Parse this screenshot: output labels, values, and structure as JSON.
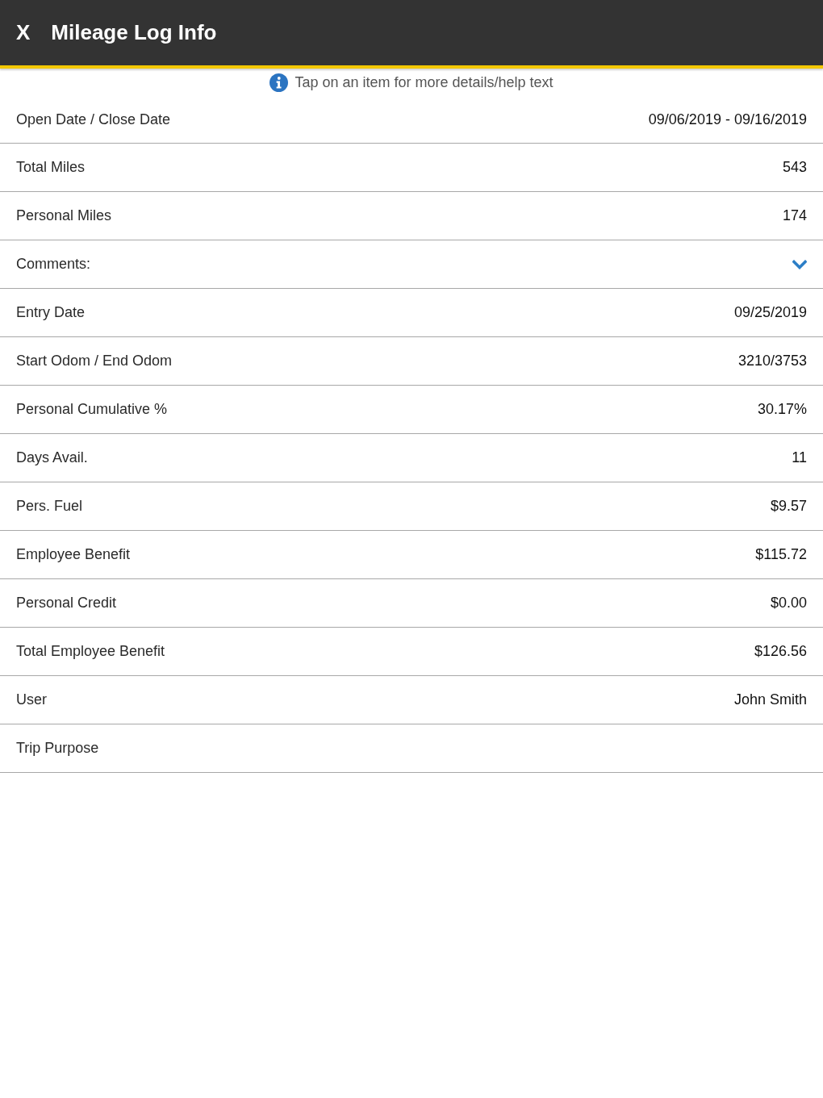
{
  "header": {
    "close_label": "X",
    "title": "Mileage Log Info"
  },
  "help": {
    "text": "Tap on an item for more details/help text"
  },
  "rows": [
    {
      "kind": "value",
      "label": "Open Date / Close Date",
      "value": "09/06/2019 - 09/16/2019"
    },
    {
      "kind": "value",
      "label": "Total Miles",
      "value": "543"
    },
    {
      "kind": "value",
      "label": "Personal Miles",
      "value": "174"
    },
    {
      "kind": "expandable",
      "label": "Comments:",
      "expanded": false
    },
    {
      "kind": "value",
      "label": "Entry Date",
      "value": "09/25/2019"
    },
    {
      "kind": "value",
      "label": "Start Odom / End Odom",
      "value": "3210/3753"
    },
    {
      "kind": "value",
      "label": "Personal Cumulative %",
      "value": "30.17%"
    },
    {
      "kind": "value",
      "label": "Days Avail.",
      "value": "11"
    },
    {
      "kind": "value",
      "label": "Pers. Fuel",
      "value": "$9.57"
    },
    {
      "kind": "value",
      "label": "Employee Benefit",
      "value": "$115.72"
    },
    {
      "kind": "value",
      "label": "Personal Credit",
      "value": "$0.00"
    },
    {
      "kind": "value",
      "label": "Total Employee Benefit",
      "value": "$126.56"
    },
    {
      "kind": "value",
      "label": "User",
      "value": "John Smith"
    },
    {
      "kind": "value",
      "label": "Trip Purpose"
    }
  ]
}
